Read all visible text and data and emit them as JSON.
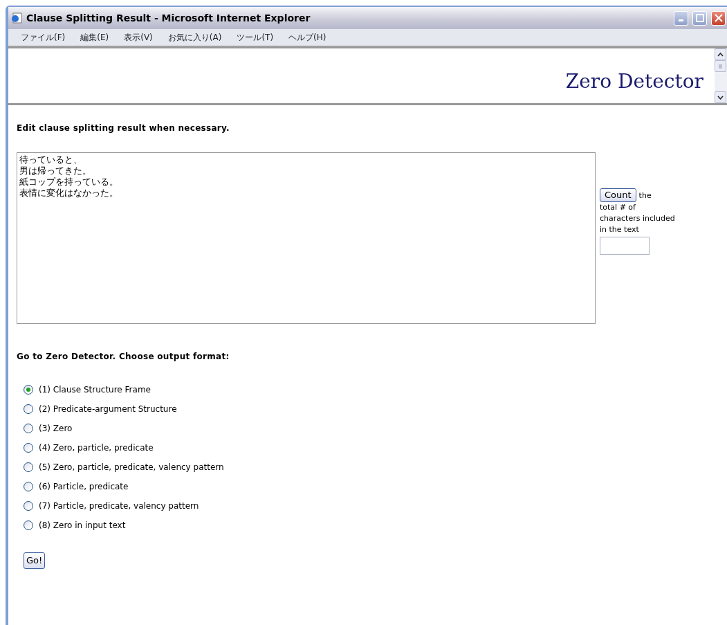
{
  "window": {
    "title": "Clause Splitting Result - Microsoft Internet Explorer"
  },
  "menu": [
    "ファイル(F)",
    "編集(E)",
    "表示(V)",
    "お気に入り(A)",
    "ツール(T)",
    "ヘルプ(H)"
  ],
  "header": {
    "logo": "Zero Detector"
  },
  "edit_heading": "Edit clause splitting result when necessary.",
  "clause_text": {
    "lines": [
      "待っていると、",
      "男は帰ってきた。",
      "紙コップを持っている。",
      "表情に変化はなかった。"
    ]
  },
  "count": {
    "button": "Count",
    "description_start": "the",
    "description_rest": "total # of characters included in the text"
  },
  "format_heading": "Go to Zero Detector. Choose output format:",
  "options": [
    {
      "label": "(1) Clause Structure Frame",
      "selected": true
    },
    {
      "label": "(2) Predicate-argument Structure",
      "selected": false
    },
    {
      "label": "(3) Zero",
      "selected": false
    },
    {
      "label": "(4) Zero, particle, predicate",
      "selected": false
    },
    {
      "label": "(5) Zero, particle, predicate, valency pattern",
      "selected": false
    },
    {
      "label": "(6) Particle, predicate",
      "selected": false
    },
    {
      "label": "(7) Particle, predicate, valency pattern",
      "selected": false
    },
    {
      "label": "(8) Zero in input text",
      "selected": false
    }
  ],
  "go_button": "Go!"
}
